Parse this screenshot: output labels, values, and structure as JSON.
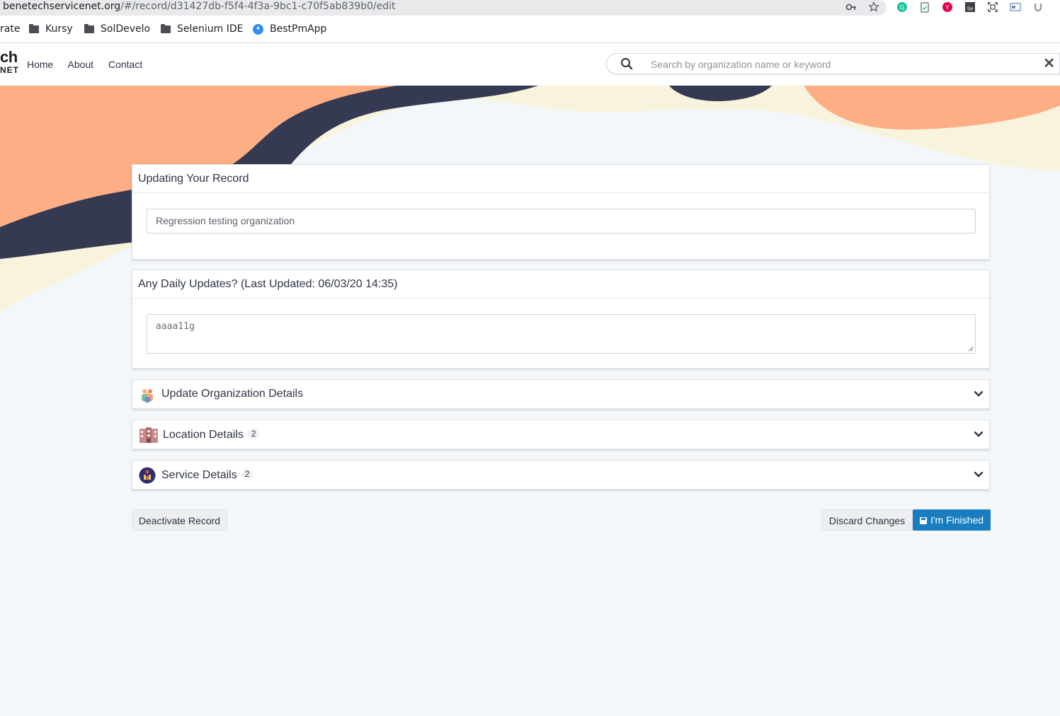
{
  "browser": {
    "url_host": "benetechservicenet.org",
    "url_path": "/#/record/d31427db-f5f4-4f3a-9bc1-c70f5ab839b0/edit",
    "bookmarks": [
      {
        "label": "rate",
        "icon": "folder-icon"
      },
      {
        "label": "Kursy",
        "icon": "folder-icon"
      },
      {
        "label": "SolDevelo",
        "icon": "folder-icon"
      },
      {
        "label": "Selenium IDE",
        "icon": "folder-icon"
      },
      {
        "label": "BestPmApp",
        "icon": "app-icon"
      }
    ]
  },
  "nav": {
    "logo_line1": "ch",
    "logo_line2": "NET",
    "links": [
      "Home",
      "About",
      "Contact"
    ],
    "search_placeholder": "Search by organization name or keyword",
    "search_clear": "✕"
  },
  "record_card": {
    "title": "Updating Your Record",
    "organization_name": "Regression testing organization"
  },
  "daily_card": {
    "title": "Any Daily Updates? (Last Updated: 06/03/20 14:35)",
    "update_text": "aaaa11g"
  },
  "sections": [
    {
      "title": "Update Organization Details",
      "badge": "",
      "icon": "organization-icon"
    },
    {
      "title": "Location Details",
      "badge": "2",
      "icon": "building-icon"
    },
    {
      "title": "Service Details",
      "badge": "2",
      "icon": "service-icon"
    }
  ],
  "actions": {
    "deactivate": "Deactivate Record",
    "discard": "Discard Changes",
    "finish": "I'm Finished"
  },
  "colors": {
    "peach": "#fdae84",
    "navy": "#353a52",
    "cream": "#f8f3dc",
    "background": "#f4f7fa",
    "primary": "#1a7dbf"
  }
}
